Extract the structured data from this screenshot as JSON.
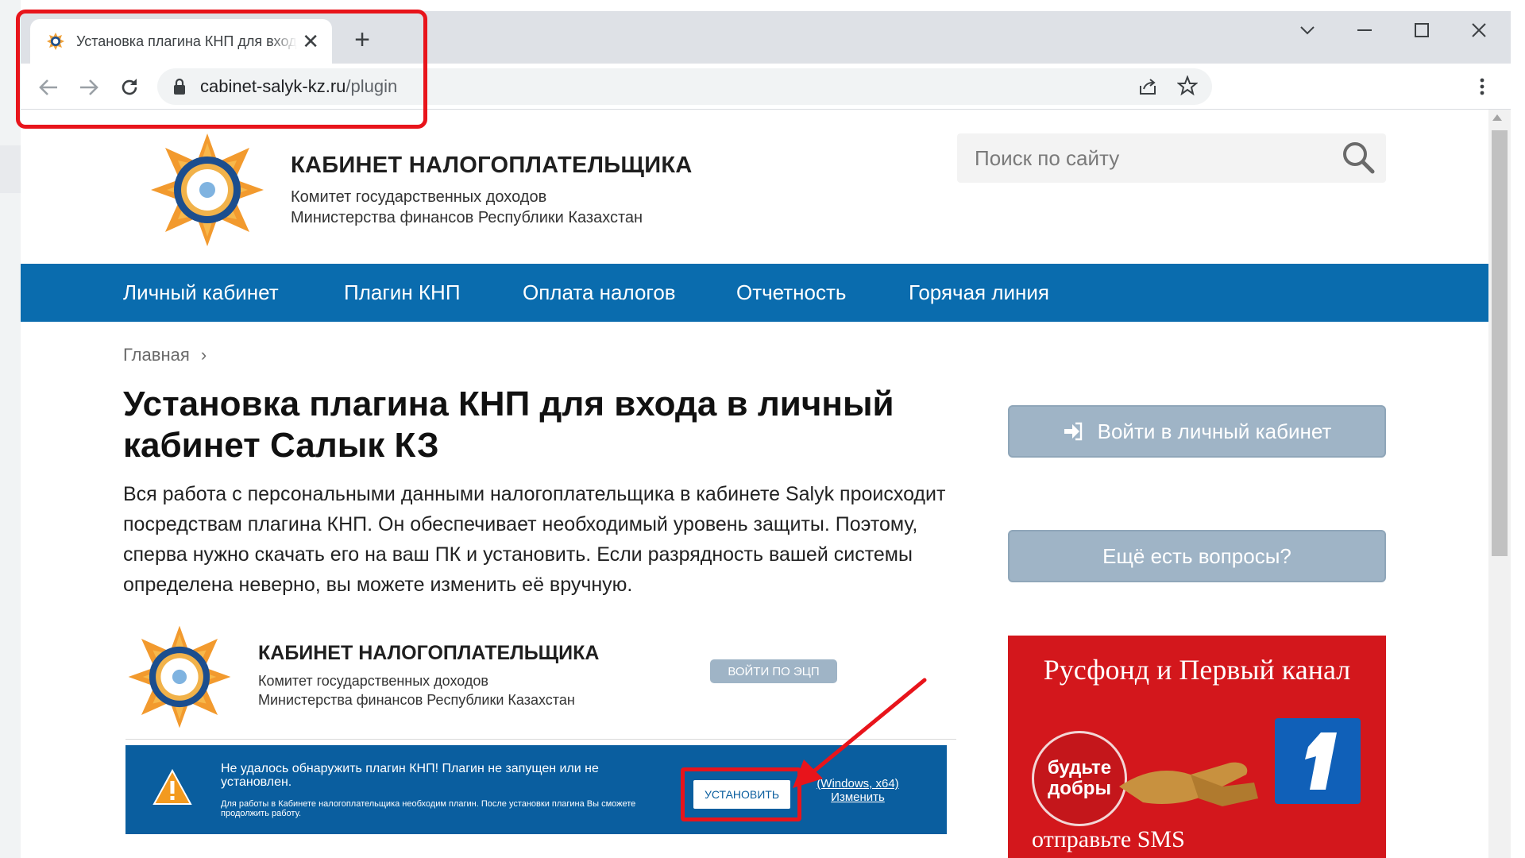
{
  "browser": {
    "tab_title": "Установка плагина КНП для входа в личный кабинет",
    "url_host": "cabinet-salyk-kz.ru",
    "url_path": "/plugin"
  },
  "site": {
    "title": "КАБИНЕТ НАЛОГОПЛАТЕЛЬЩИКА",
    "subtitle_line1": "Комитет государственных доходов",
    "subtitle_line2": "Министерства финансов Республики Казахстан",
    "search_placeholder": "Поиск по сайту"
  },
  "nav": {
    "items": [
      {
        "label": "Личный кабинет"
      },
      {
        "label": "Плагин КНП"
      },
      {
        "label": "Оплата налогов"
      },
      {
        "label": "Отчетность"
      },
      {
        "label": "Горячая линия"
      }
    ]
  },
  "breadcrumb": {
    "home": "Главная",
    "separator": "›"
  },
  "article": {
    "title": "Установка плагина КНП для входа в личный кабинет Салык КЗ",
    "intro": "Вся работа с персональными данными налогоплательщика в кабинете Salyk происходит посредствам плагина КНП. Он обеспечивает необходимый уровень защиты. Поэтому, сперва нужно скачать его на ваш ПК и установить. Если разрядность вашей системы определена неверно, вы можете изменить её вручную."
  },
  "sidebar": {
    "login_button": "Войти в личный кабинет",
    "questions_button": "Ещё есть вопросы?",
    "banner": {
      "headline": "Русфонд и Первый канал",
      "badge_line1": "будьте",
      "badge_line2": "добры",
      "footer": "отправьте SMS"
    }
  },
  "embedded": {
    "title": "КАБИНЕТ НАЛОГОПЛАТЕЛЬЩИКА",
    "subtitle_line1": "Комитет государственных доходов",
    "subtitle_line2": "Министерства финансов Республики Казахстан",
    "ecp_button": "ВОЙТИ ПО ЭЦП",
    "alert": {
      "message": "Не удалось обнаружить плагин КНП! Плагин не запущен или не установлен.",
      "note": "Для работы в Кабинете налогоплательщика необходим плагин. После установки плагина Вы сможете продолжить работу.",
      "install_button": "УСТАНОВИТЬ",
      "arch_label": "(Windows, x64)",
      "change_link": "Изменить"
    }
  },
  "colors": {
    "nav_blue": "#0a6cae",
    "alert_blue": "#0a5e9f",
    "button_grey_blue": "#9fb4c6",
    "highlight_red": "#e8141b",
    "banner_red": "#d3171c"
  },
  "icons": {
    "tab_favicon": "emblem-icon",
    "back": "arrow-left-icon",
    "forward": "arrow-right-icon",
    "reload": "reload-icon",
    "lock": "lock-icon",
    "share": "share-icon",
    "bookmark": "star-icon",
    "menu": "kebab-menu-icon",
    "search": "search-icon",
    "login": "sign-in-icon",
    "warning": "warning-icon"
  }
}
